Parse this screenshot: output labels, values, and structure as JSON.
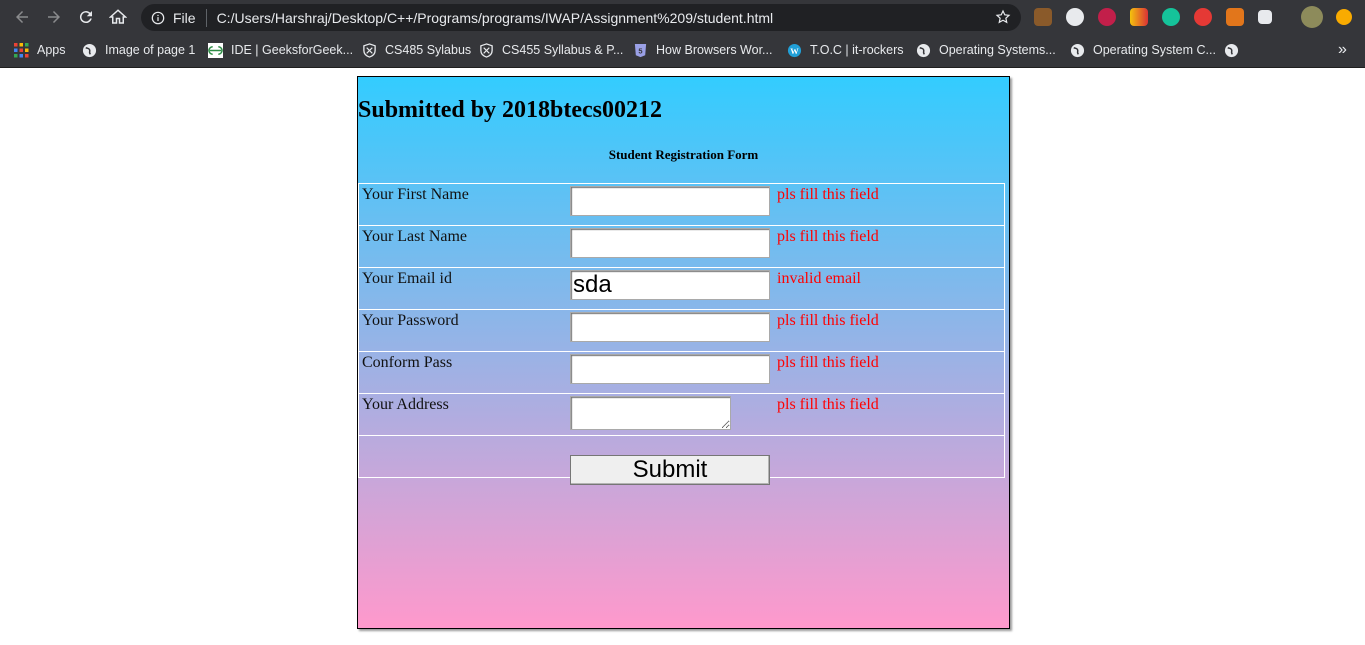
{
  "browser": {
    "url_prefix": "File",
    "url": "C:/Users/Harshraj/Desktop/C++/Programs/programs/IWAP/Assignment%209/student.html",
    "bookmarks": [
      {
        "label": "Apps",
        "icon": "apps-grid-icon"
      },
      {
        "label": "Image of page 1",
        "icon": "globe-icon"
      },
      {
        "label": "IDE | GeeksforGeek...",
        "icon": "geeksforgeeks-icon"
      },
      {
        "label": "CS485 Sylabus",
        "icon": "shield-icon"
      },
      {
        "label": "CS455 Syllabus & P...",
        "icon": "shield-icon"
      },
      {
        "label": "How Browsers Wor...",
        "icon": "html5-icon"
      },
      {
        "label": "T.O.C | it-rockers",
        "icon": "wordpress-icon"
      },
      {
        "label": "Operating Systems...",
        "icon": "globe-icon"
      },
      {
        "label": "Operating System C...",
        "icon": "globe-icon"
      }
    ],
    "more_bookmarks": "»"
  },
  "page": {
    "heading": "Submitted by 2018btecs00212",
    "form_title": "Student Registration Form",
    "fields": [
      {
        "label": "Your First Name",
        "value": "",
        "error": "pls fill this field",
        "type": "text"
      },
      {
        "label": "Your Last Name",
        "value": "",
        "error": "pls fill this field",
        "type": "text"
      },
      {
        "label": "Your Email id",
        "value": "sda",
        "error": "invalid email",
        "type": "text"
      },
      {
        "label": "Your Password",
        "value": "",
        "error": "pls fill this field",
        "type": "password"
      },
      {
        "label": "Conform Pass",
        "value": "",
        "error": "pls fill this field",
        "type": "password"
      },
      {
        "label": "Your Address",
        "value": "",
        "error": "pls fill this field",
        "type": "textarea"
      }
    ],
    "submit_label": "Submit"
  },
  "colors": {
    "gradient_top": "#33ccff",
    "gradient_bottom": "#ff99cc",
    "error": "#ff0000",
    "chrome_bg": "#35363a"
  }
}
